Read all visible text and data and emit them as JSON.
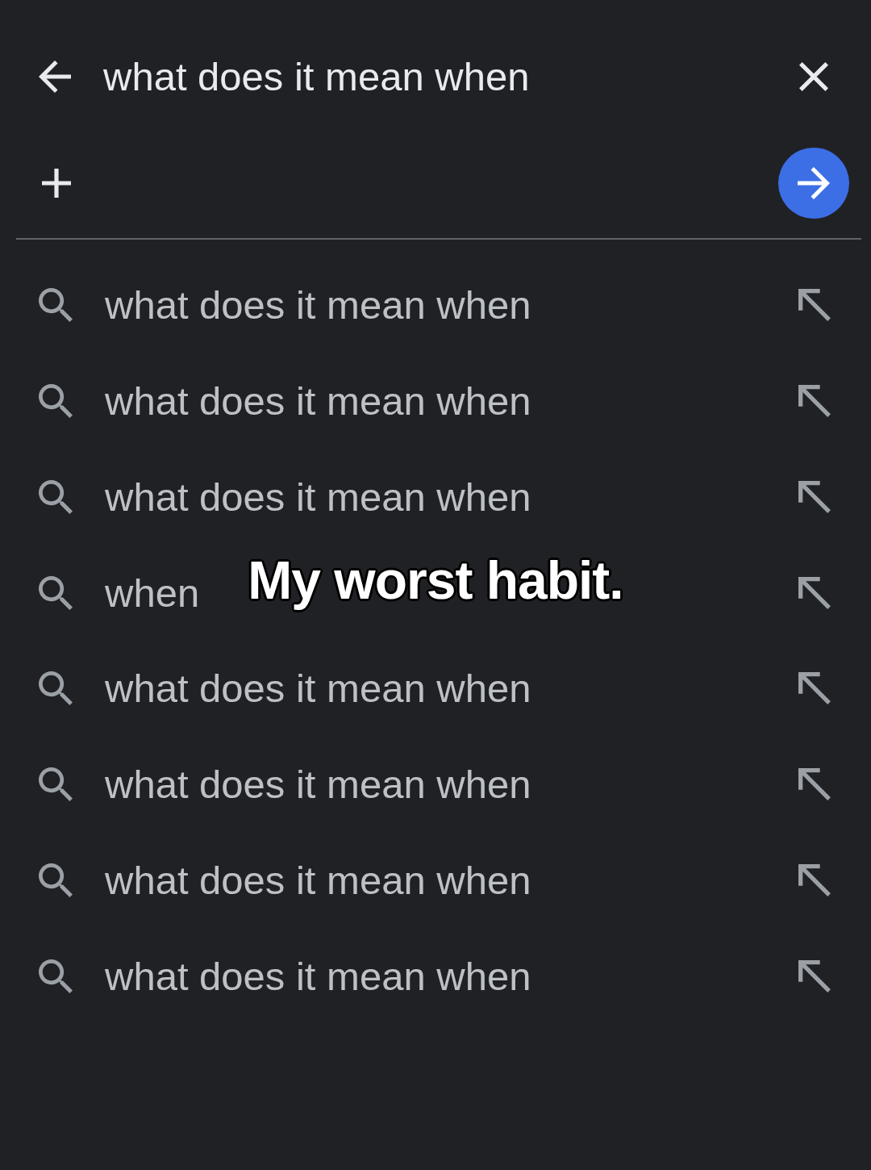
{
  "search_bar": {
    "query": "what does it mean when"
  },
  "suggestions": [
    {
      "text": "what does it mean when"
    },
    {
      "text": "what does it mean when"
    },
    {
      "text": "what does it mean when"
    },
    {
      "text": "when"
    },
    {
      "text": "what does it mean when"
    },
    {
      "text": "what does it mean when"
    },
    {
      "text": "what does it mean when"
    },
    {
      "text": "what does it mean when"
    }
  ],
  "caption": "My worst habit."
}
